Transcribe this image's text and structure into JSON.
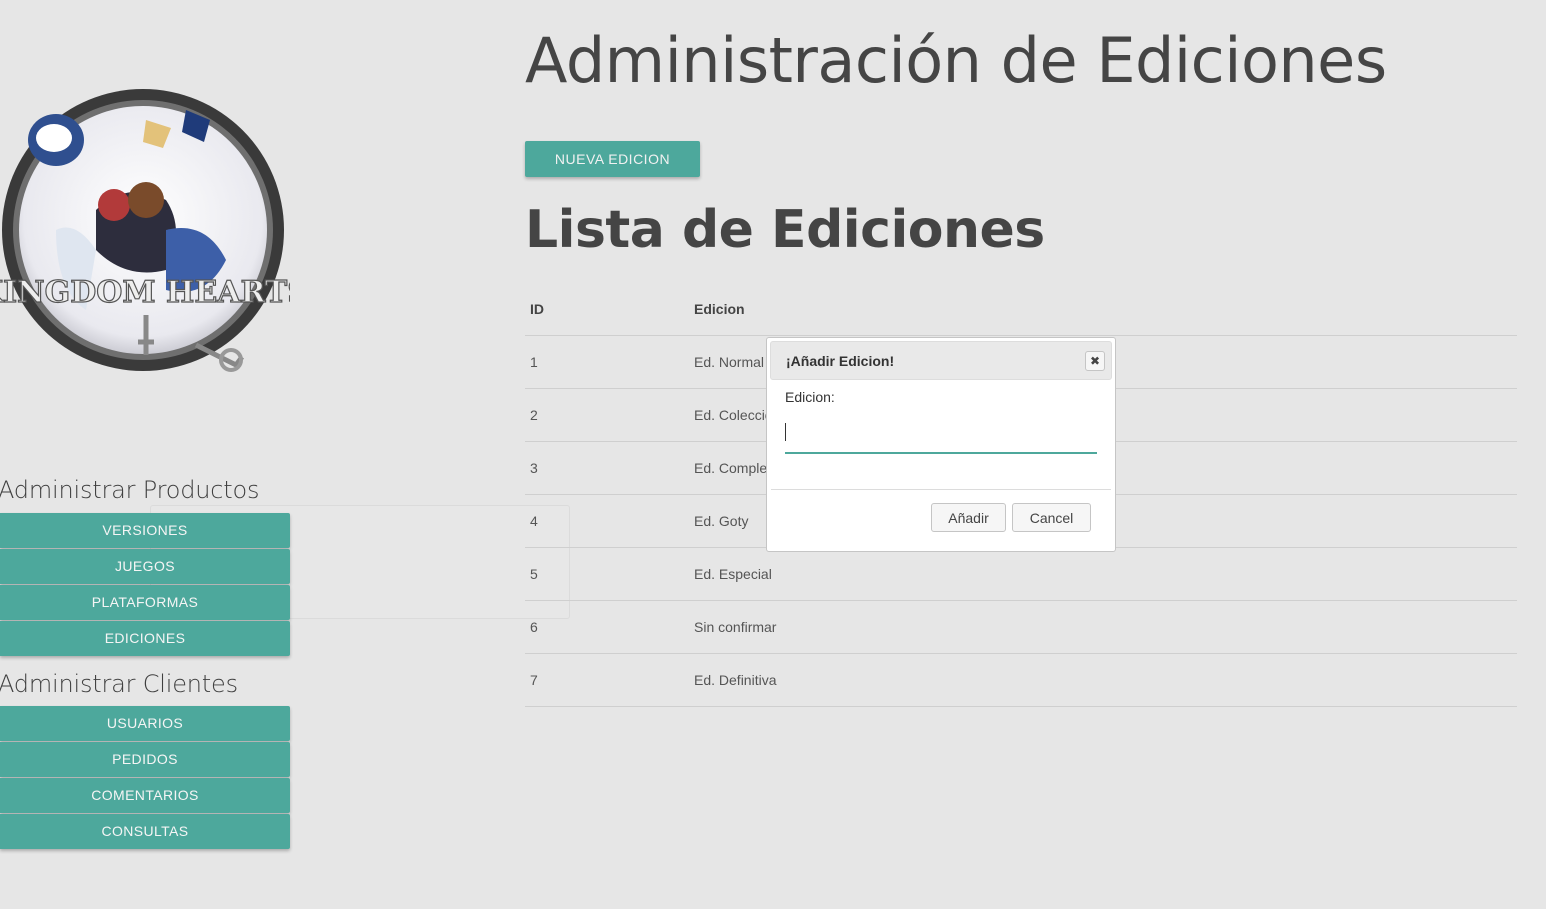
{
  "sidebar": {
    "logo_alt": "Kingdom Hearts",
    "products": {
      "title": "Administrar Productos",
      "buttons": [
        "VERSIONES",
        "JUEGOS",
        "PLATAFORMAS",
        "EDICIONES"
      ]
    },
    "clients": {
      "title": "Administrar Clientes",
      "buttons": [
        "USUARIOS",
        "PEDIDOS",
        "COMENTARIOS",
        "CONSULTAS"
      ]
    }
  },
  "main": {
    "title": "Administración de Ediciones",
    "new_button": "NUEVA EDICION",
    "list_title": "Lista de Ediciones",
    "table": {
      "headers": [
        "ID",
        "Edicion"
      ],
      "rows": [
        [
          "1",
          "Ed. Normal"
        ],
        [
          "2",
          "Ed. Coleccionista"
        ],
        [
          "3",
          "Ed. Completa"
        ],
        [
          "4",
          "Ed. Goty"
        ],
        [
          "5",
          "Ed. Especial"
        ],
        [
          "6",
          "Sin confirmar"
        ],
        [
          "7",
          "Ed. Definitiva"
        ]
      ]
    }
  },
  "dialog": {
    "title": "¡Añadir Edicion!",
    "close_icon": "close-icon",
    "field_label": "Edicion:",
    "field_value": "",
    "add_button": "Añadir",
    "cancel_button": "Cancel"
  },
  "colors": {
    "accent": "#4da89c",
    "background": "#e6e6e6"
  }
}
